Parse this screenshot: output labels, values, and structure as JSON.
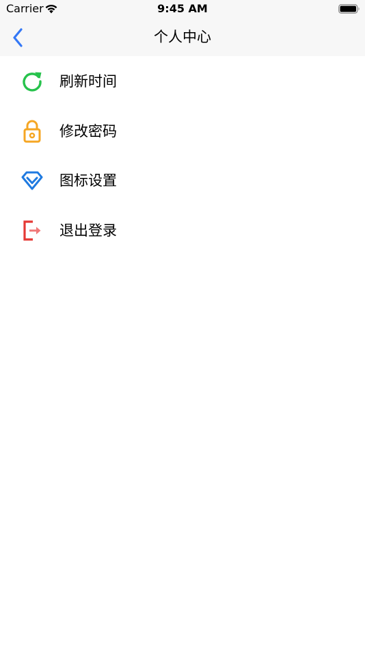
{
  "status_bar": {
    "carrier": "Carrier",
    "time": "9:45 AM"
  },
  "nav": {
    "title": "个人中心",
    "back_icon": "chevron-left-icon",
    "accent_color": "#3478f6"
  },
  "menu": {
    "items": [
      {
        "label": "刷新时间",
        "icon": "refresh-icon",
        "color": "#27c24c"
      },
      {
        "label": "修改密码",
        "icon": "lock-icon",
        "color": "#f5a623"
      },
      {
        "label": "图标设置",
        "icon": "diamond-icon",
        "color": "#1f7ae0"
      },
      {
        "label": "退出登录",
        "icon": "logout-icon",
        "color": "#e53935"
      }
    ]
  }
}
